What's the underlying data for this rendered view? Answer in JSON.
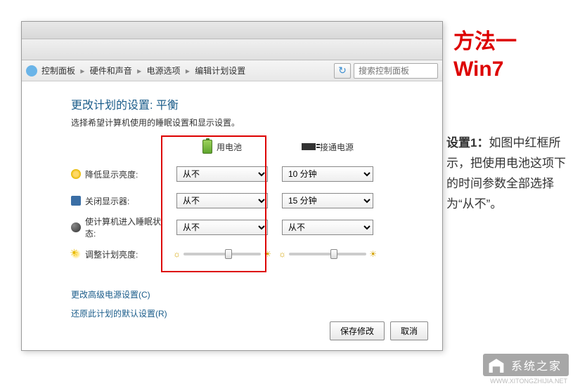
{
  "breadcrumb": {
    "items": [
      "控制面板",
      "硬件和声音",
      "电源选项",
      "编辑计划设置"
    ]
  },
  "search": {
    "placeholder": "搜索控制面板"
  },
  "heading": {
    "prefix": "更改计划的设置:",
    "plan": "平衡"
  },
  "subtext": "选择希望计算机使用的睡眠设置和显示设置。",
  "columns": {
    "battery": "用电池",
    "plugged": "接通电源"
  },
  "rows": {
    "dim": {
      "label": "降低显示亮度:",
      "battery": "从不",
      "plugged": "10 分钟"
    },
    "off": {
      "label": "关闭显示器:",
      "battery": "从不",
      "plugged": "15 分钟"
    },
    "sleep": {
      "label": "使计算机进入睡眠状态:",
      "battery": "从不",
      "plugged": "从不"
    },
    "bright": {
      "label": "调整计划亮度:"
    }
  },
  "brightness": {
    "battery_pct": 65,
    "plugged_pct": 65
  },
  "links": {
    "advanced": "更改高级电源设置(C)",
    "restore": "还原此计划的默认设置(R)"
  },
  "buttons": {
    "save": "保存修改",
    "cancel": "取消"
  },
  "side": {
    "title_l1": "方法一",
    "title_l2": "Win7",
    "step_label": "设置1：",
    "step_text": "如图中红框所示，把使用电池这项下的时间参数全部选择为“从不”。"
  },
  "logo": {
    "name": "系统之家",
    "url": "WWW.XITONGZHIJIA.NET"
  }
}
